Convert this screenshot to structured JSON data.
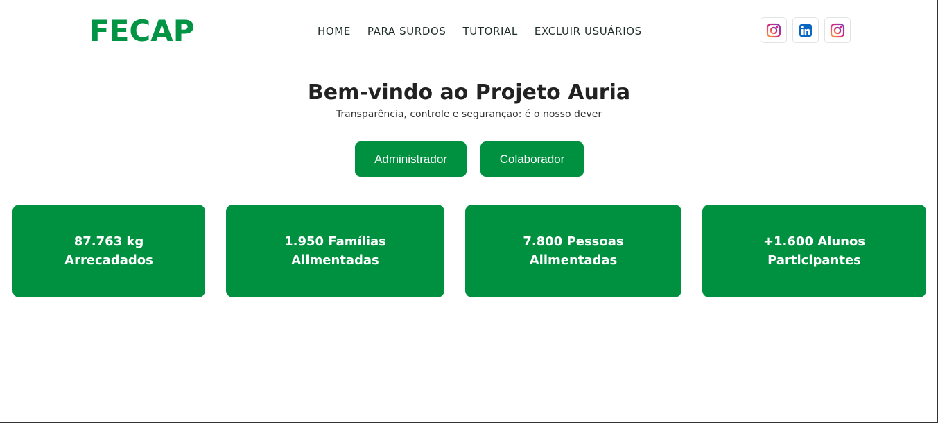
{
  "header": {
    "logo": "FECAP",
    "nav": [
      "HOME",
      "PARA SURDOS",
      "TUTORIAL",
      "EXCLUIR USUÁRIOS"
    ],
    "social_icons": [
      "instagram-icon",
      "linkedin-icon",
      "instagram-icon"
    ]
  },
  "hero": {
    "title": "Bem-vindo ao Projeto Auria",
    "subtitle": "Transparência, controle e segurançao: é o nosso dever",
    "buttons": [
      "Administrador",
      "Colaborador"
    ]
  },
  "stats": [
    {
      "line1": "87.763 kg",
      "line2": "Arrecadados"
    },
    {
      "line1": "1.950 Famílias",
      "line2": "Alimentadas"
    },
    {
      "line1": "7.800 Pessoas",
      "line2": "Alimentadas"
    },
    {
      "line1": "+1.600 Alunos",
      "line2": "Participantes"
    }
  ],
  "colors": {
    "brand_green": "#009444",
    "card_green": "#009140",
    "instagram_gradient": [
      "#f9a03f",
      "#d62976",
      "#7b3fbf"
    ],
    "linkedin_blue": "#0a66c2"
  }
}
